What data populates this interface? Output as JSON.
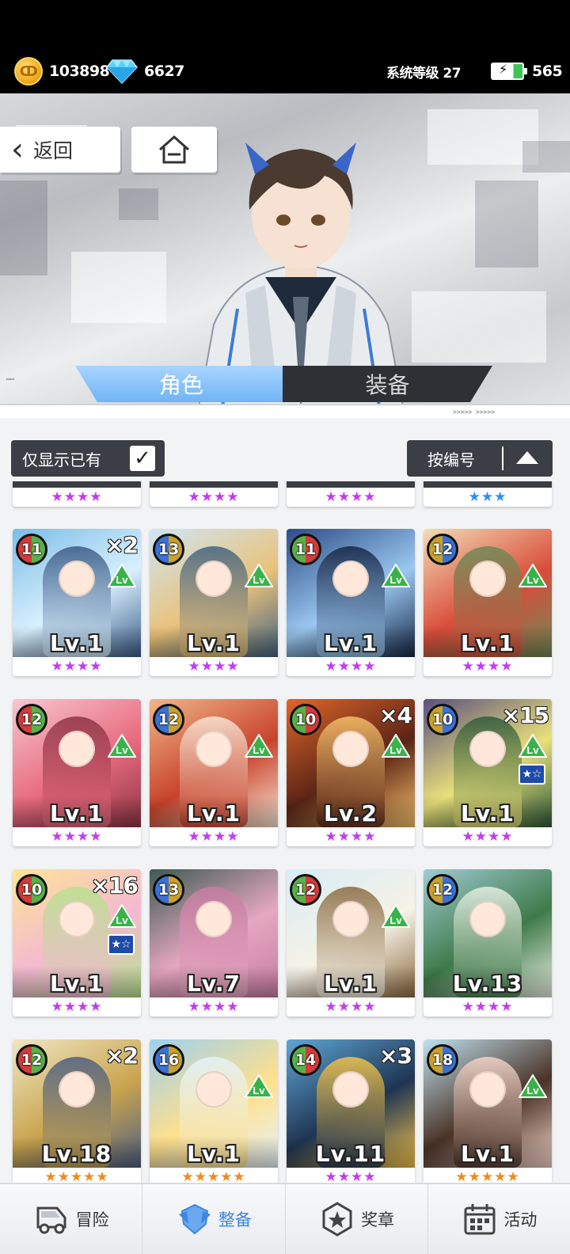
{
  "resources": {
    "coins": "103898",
    "gems": "6627",
    "system_level": "系统等级 27",
    "energy": "565"
  },
  "nav_buttons": {
    "back_label": "返回"
  },
  "tabs": [
    {
      "label": "角色",
      "active": true
    },
    {
      "label": "装备",
      "active": false
    }
  ],
  "filters": {
    "owned_only_label": "仅显示已有",
    "owned_only_checked": true,
    "sort_label": "按编号"
  },
  "partial_row_stars": [
    {
      "stars": "★★★★",
      "color": "#c23cf0"
    },
    {
      "stars": "★★★★",
      "color": "#c23cf0"
    },
    {
      "stars": "★★★★",
      "color": "#c23cf0"
    },
    {
      "stars": "★★★",
      "color": "#2f8df2"
    }
  ],
  "cards": [
    {
      "badge": "11",
      "dup": "×2",
      "level": "Lv.1",
      "stars": "★★★★",
      "star_color": "#c23cf0",
      "lv_up": true,
      "star_up": false,
      "palette": [
        "#7bbde6",
        "#d9f0ff",
        "#3a5b86"
      ]
    },
    {
      "badge": "13",
      "dup": "",
      "level": "Lv.1",
      "stars": "★★★★",
      "star_color": "#c23cf0",
      "lv_up": true,
      "star_up": false,
      "palette": [
        "#cfe6f5",
        "#e9c27a",
        "#42627f"
      ]
    },
    {
      "badge": "11",
      "dup": "",
      "level": "Lv.1",
      "stars": "★★★★",
      "star_color": "#c23cf0",
      "lv_up": true,
      "star_up": false,
      "palette": [
        "#2c4c86",
        "#9ac7ef",
        "#152646"
      ]
    },
    {
      "badge": "12",
      "dup": "",
      "level": "Lv.1",
      "stars": "★★★★",
      "star_color": "#c23cf0",
      "lv_up": true,
      "star_up": false,
      "palette": [
        "#f2dcb6",
        "#d94d3a",
        "#6b8a56"
      ]
    },
    {
      "badge": "12",
      "dup": "",
      "level": "Lv.1",
      "stars": "★★★★",
      "star_color": "#c23cf0",
      "lv_up": true,
      "star_up": false,
      "palette": [
        "#f7c7cf",
        "#e86b7e",
        "#8d3445"
      ]
    },
    {
      "badge": "12",
      "dup": "",
      "level": "Lv.1",
      "stars": "★★★★",
      "star_color": "#c23cf0",
      "lv_up": true,
      "star_up": false,
      "palette": [
        "#f0b68a",
        "#c8432c",
        "#f7e6d4"
      ]
    },
    {
      "badge": "10",
      "dup": "×4",
      "level": "Lv.2",
      "stars": "★★★★",
      "star_color": "#c23cf0",
      "lv_up": true,
      "star_up": false,
      "palette": [
        "#e0662a",
        "#5a2416",
        "#f6c16b"
      ]
    },
    {
      "badge": "10",
      "dup": "×15",
      "level": "Lv.1",
      "stars": "★★★★",
      "star_color": "#c23cf0",
      "lv_up": true,
      "star_up": true,
      "palette": [
        "#5a4f7e",
        "#e9e07a",
        "#2f5a3a"
      ]
    },
    {
      "badge": "10",
      "dup": "×16",
      "level": "Lv.1",
      "stars": "★★★★",
      "star_color": "#c23cf0",
      "lv_up": true,
      "star_up": true,
      "palette": [
        "#ffe596",
        "#f3b9d1",
        "#b6e28e"
      ]
    },
    {
      "badge": "13",
      "dup": "",
      "level": "Lv.7",
      "stars": "★★★★",
      "star_color": "#c23cf0",
      "lv_up": false,
      "star_up": false,
      "palette": [
        "#3c5a52",
        "#e5a7c0",
        "#c77da3"
      ]
    },
    {
      "badge": "12",
      "dup": "",
      "level": "Lv.1",
      "stars": "★★★★",
      "star_color": "#c23cf0",
      "lv_up": true,
      "star_up": false,
      "palette": [
        "#d8ecf6",
        "#f6f2e6",
        "#8a6a40"
      ]
    },
    {
      "badge": "12",
      "dup": "",
      "level": "Lv.13",
      "stars": "★★★★",
      "star_color": "#c23cf0",
      "lv_up": false,
      "star_up": false,
      "palette": [
        "#9fcbd3",
        "#3f7a4a",
        "#e8efe3"
      ]
    },
    {
      "badge": "12",
      "dup": "×2",
      "level": "Lv.18",
      "stars": "★★★★★",
      "star_color": "#f08a1e",
      "lv_up": false,
      "star_up": false,
      "palette": [
        "#efe6c4",
        "#c9a44e",
        "#4c5f83"
      ]
    },
    {
      "badge": "16",
      "dup": "",
      "level": "Lv.1",
      "stars": "★★★★★",
      "star_color": "#f08a1e",
      "lv_up": true,
      "star_up": false,
      "palette": [
        "#9ed0f0",
        "#ffe08c",
        "#e5f3fb"
      ]
    },
    {
      "badge": "14",
      "dup": "×3",
      "level": "Lv.11",
      "stars": "★★★★",
      "star_color": "#c23cf0",
      "lv_up": false,
      "star_up": false,
      "palette": [
        "#5fa6d6",
        "#1f3552",
        "#f3c34a"
      ]
    },
    {
      "badge": "18",
      "dup": "",
      "level": "Lv.1",
      "stars": "★★★★★",
      "star_color": "#f08a1e",
      "lv_up": true,
      "star_up": false,
      "palette": [
        "#bfe1ef",
        "#4a3226",
        "#f4d5c8"
      ]
    }
  ],
  "bottom_nav": [
    {
      "label": "冒险",
      "icon": "truck-icon",
      "active": false
    },
    {
      "label": "整备",
      "icon": "armor-icon",
      "active": true
    },
    {
      "label": "奖章",
      "icon": "medal-icon",
      "active": false
    },
    {
      "label": "活动",
      "icon": "calendar-icon",
      "active": false
    }
  ]
}
